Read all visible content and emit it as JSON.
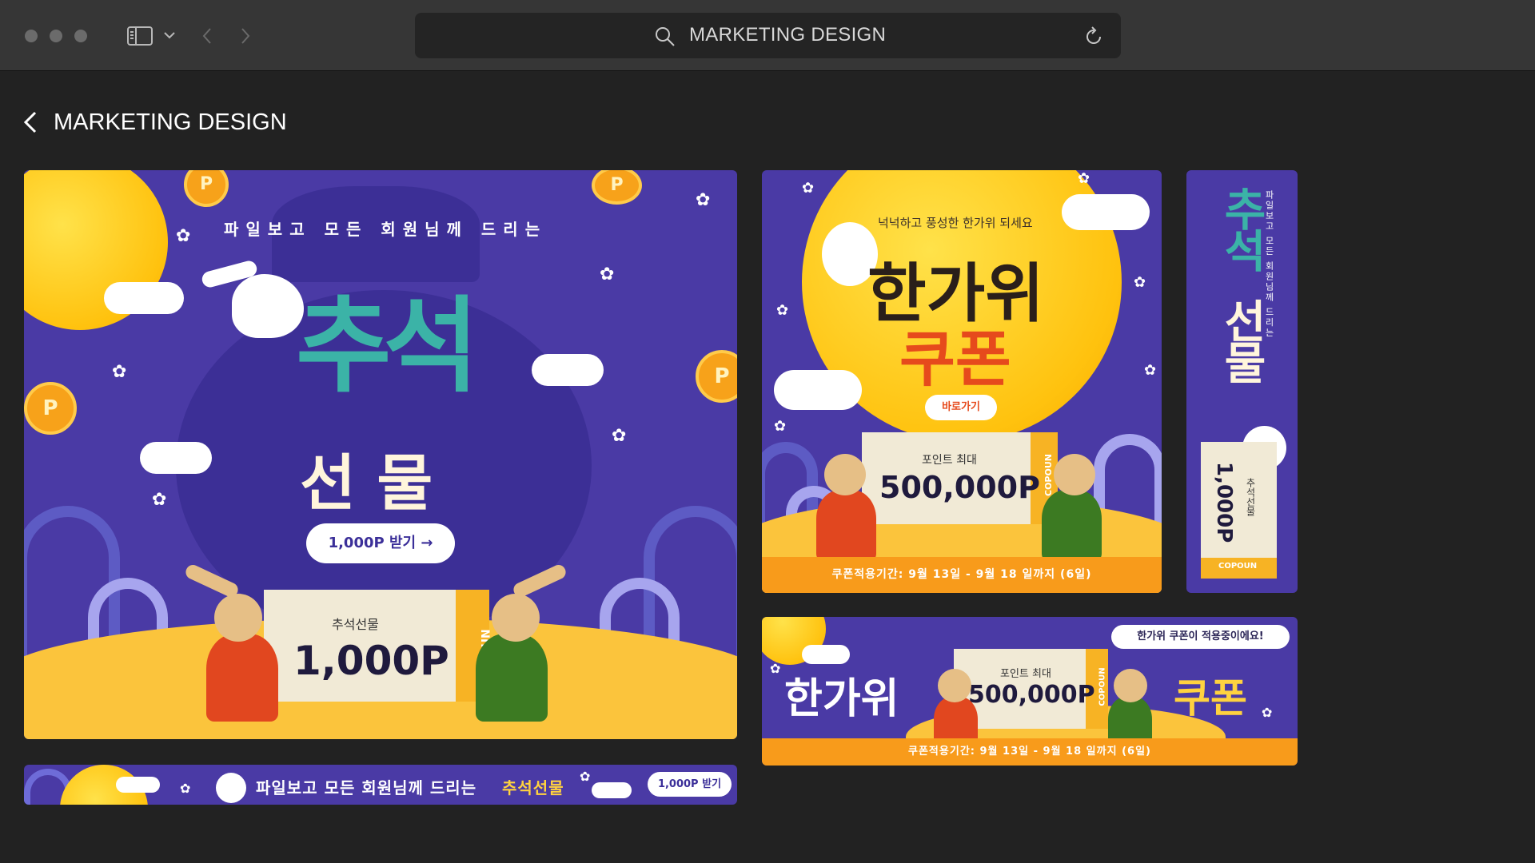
{
  "browser": {
    "address": "MARKETING DESIGN"
  },
  "page": {
    "title": "MARKETING DESIGN"
  },
  "banner_main": {
    "tagline": "파일보고 모든 회원님께 드리는",
    "title_top": "추석",
    "title_bottom": "선 물",
    "button_label": "1,000P 받기 →",
    "ticket_label": "추석선물",
    "ticket_value": "1,000P",
    "coupon_mark": "COPOUN"
  },
  "banner_wide": {
    "tagline": "파일보고 모든 회원님께 드리는",
    "highlight": "추석선물",
    "button_label": "1,000P 받기"
  },
  "banner_square": {
    "tagline": "넉넉하고 풍성한 한가위 되세요",
    "title": "한가위",
    "subtitle": "쿠폰",
    "button_label": "바로가기",
    "ticket_label": "포인트 최대",
    "ticket_value": "500,000P",
    "coupon_mark": "COPOUN",
    "footer": "쿠폰적용기간: 9월 13일 - 9월 18 일까지 (6일)"
  },
  "banner_vertical": {
    "title_1": "추석",
    "title_2": "선물",
    "tagline": "파일보고 모든 회원님께 드리는",
    "ticket_label": "추석선물",
    "ticket_value": "1,000P",
    "coupon_mark": "COPOUN"
  },
  "banner_landscape": {
    "title": "한가위",
    "subtitle": "쿠폰",
    "ticket_label": "포인트 최대",
    "ticket_value": "500,000P",
    "speech": "한가위 쿠폰이 적용중이에요!",
    "coupon_mark": "COPOUN",
    "footer": "쿠폰적용기간: 9월 13일 - 9월 18 일까지 (6일)"
  }
}
